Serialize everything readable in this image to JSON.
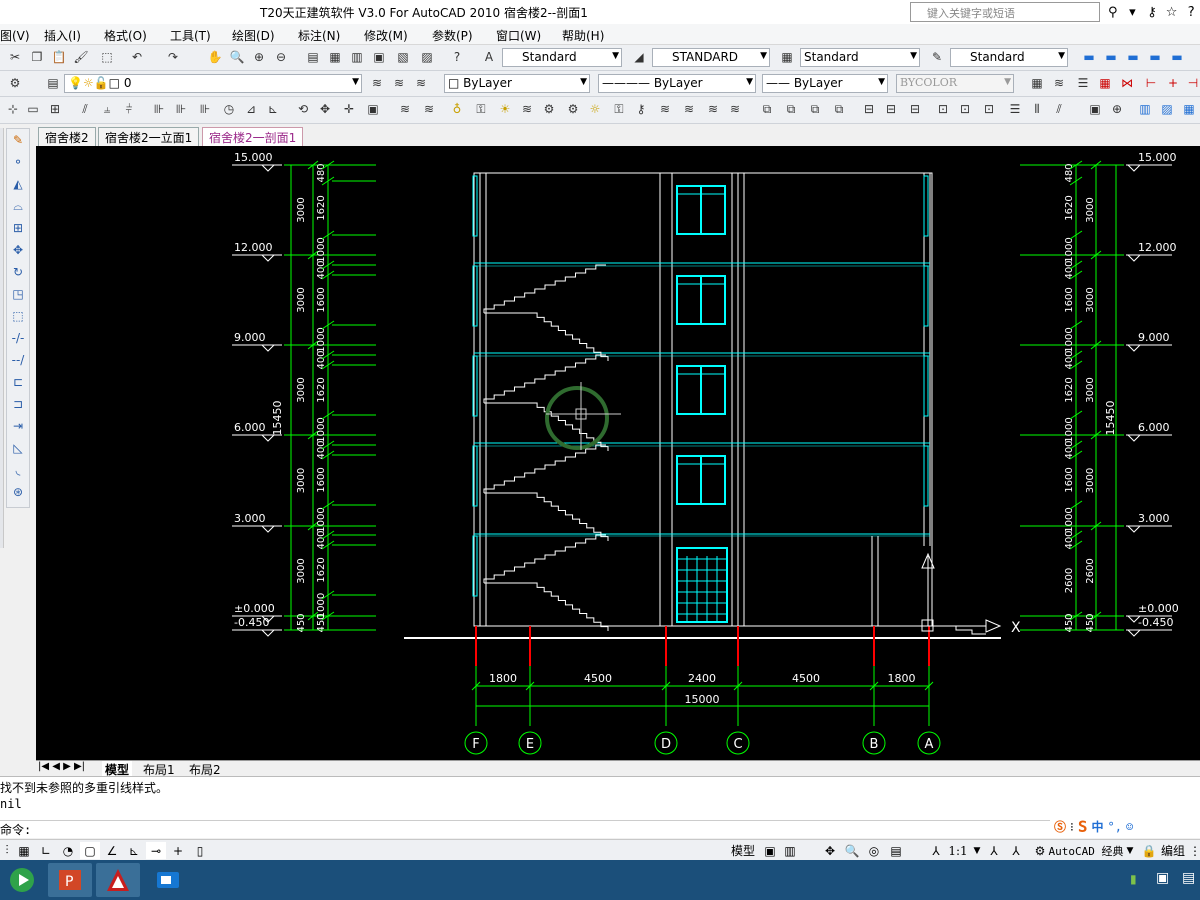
{
  "window": {
    "title": "T20天正建筑软件 V3.0 For AutoCAD 2010     宿舍楼2--剖面1",
    "search_placeholder": "键入关键字或短语"
  },
  "menu": [
    {
      "label": "图(V)"
    },
    {
      "label": "插入(I)"
    },
    {
      "label": "格式(O)"
    },
    {
      "label": "工具(T)"
    },
    {
      "label": "绘图(D)"
    },
    {
      "label": "标注(N)"
    },
    {
      "label": "修改(M)"
    },
    {
      "label": "参数(P)"
    },
    {
      "label": "窗口(W)"
    },
    {
      "label": "帮助(H)"
    }
  ],
  "styles": {
    "text_style": "Standard",
    "dim_style": "STANDARD",
    "table_style": "Standard",
    "mleader_style": "Standard"
  },
  "layers": {
    "current": "0",
    "color": "ByLayer",
    "linetype": "ByLayer",
    "lineweight": "ByLayer",
    "plotstyle": "BYCOLOR"
  },
  "doc_tabs": [
    {
      "label": "宿舍楼2",
      "active": false
    },
    {
      "label": "宿舍楼2一立面1",
      "active": false
    },
    {
      "label": "宿舍楼2一剖面1",
      "active": true
    }
  ],
  "layout_tabs": [
    {
      "label": "模型",
      "active": true
    },
    {
      "label": "布局1",
      "active": false
    },
    {
      "label": "布局2",
      "active": false
    }
  ],
  "command": {
    "lines": [
      "找不到未参照的多重引线样式。",
      "nil"
    ],
    "prompt": "命令:"
  },
  "status": {
    "model": "模型",
    "scale": "1:1",
    "workspace": "AutoCAD 经典",
    "edit": "编组"
  },
  "drawing": {
    "left_levels": [
      "15.000",
      "12.000",
      "9.000",
      "6.000",
      "3.000",
      "±0.000",
      "-0.450"
    ],
    "right_levels": [
      "15.000",
      "12.000",
      "9.000",
      "6.000",
      "3.000",
      "±0.000",
      "-0.450"
    ],
    "left_dims": [
      "3000",
      "3000",
      "3000",
      "3000",
      "3000",
      "450"
    ],
    "left_sub_dims": [
      "480",
      "1620",
      "1000",
      "400",
      "1600",
      "1000",
      "400",
      "1620",
      "1000",
      "400",
      "1600",
      "1000",
      "400",
      "1620",
      "1000",
      "450"
    ],
    "total_height": "15450",
    "right_dims": [
      "3000",
      "3000",
      "3000",
      "3000",
      "2600",
      "450"
    ],
    "right_sub_dims": [
      "480",
      "1620",
      "1000",
      "400",
      "1600",
      "1000",
      "400",
      "1620",
      "1000",
      "400",
      "1600",
      "1000",
      "400",
      "2600",
      "450"
    ],
    "bottom_dims": [
      "1800",
      "4500",
      "2400",
      "4500",
      "1800"
    ],
    "bottom_total": "15000",
    "axes": [
      "F",
      "E",
      "D",
      "C",
      "B",
      "A"
    ],
    "ucs_x": "X"
  },
  "colors": {
    "cad_bg": "#000000",
    "green": "#00ff00",
    "cyan": "#00ffff",
    "red": "#ff0000",
    "white": "#ffffff",
    "taskbar": "#1b4f7a"
  }
}
